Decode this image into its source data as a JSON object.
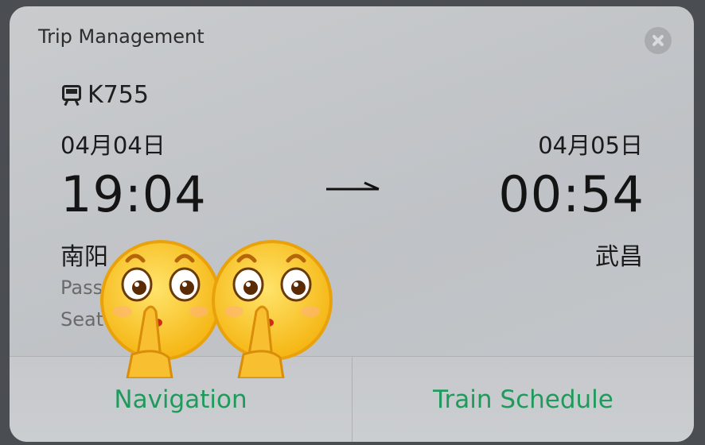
{
  "window": {
    "title": "Trip Management"
  },
  "trip": {
    "train_number": "K755",
    "departure": {
      "date": "04月04日",
      "time": "19:04",
      "station": "南阳"
    },
    "arrival": {
      "date": "04月05日",
      "time": "00:54",
      "station": "武昌"
    },
    "passenger_label_partial": "Pass",
    "seat_label_partial": "Seat"
  },
  "actions": {
    "navigation": "Navigation",
    "train_schedule": "Train Schedule"
  },
  "icons": {
    "close": "close-icon",
    "train": "train-icon",
    "arrow": "arrow-right-icon",
    "emoji": "shush-emoji-sticker"
  },
  "colors": {
    "accent": "#1f9a5c",
    "card_bg": "#c4c6c9"
  }
}
